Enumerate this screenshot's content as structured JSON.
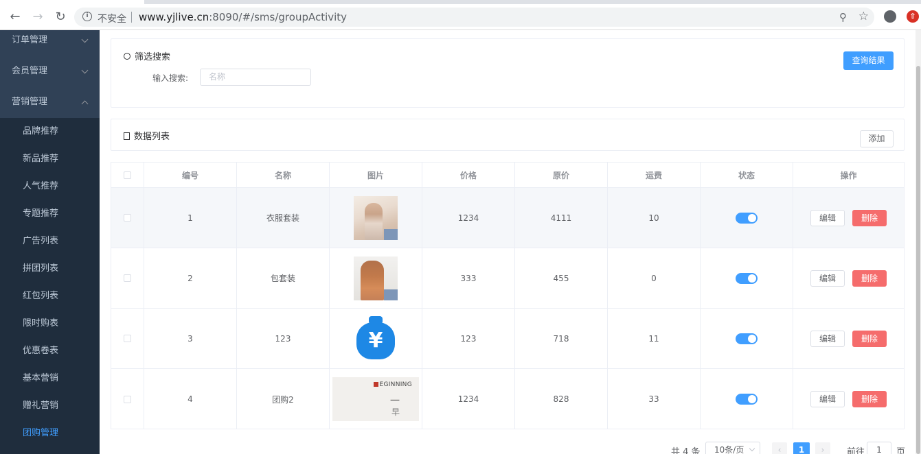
{
  "browser": {
    "security_label": "不安全",
    "url_host": "www.yjlive.cn",
    "url_rest": ":8090/#/sms/groupActivity"
  },
  "sidebar": {
    "groups": [
      {
        "label": "订单管理",
        "expanded": false
      },
      {
        "label": "会员管理",
        "expanded": false
      },
      {
        "label": "营销管理",
        "expanded": true
      }
    ],
    "items": [
      {
        "label": "品牌推荐"
      },
      {
        "label": "新品推荐"
      },
      {
        "label": "人气推荐"
      },
      {
        "label": "专题推荐"
      },
      {
        "label": "广告列表"
      },
      {
        "label": "拼团列表"
      },
      {
        "label": "红包列表"
      },
      {
        "label": "限时购表"
      },
      {
        "label": "优惠卷表"
      },
      {
        "label": "基本营销"
      },
      {
        "label": "赠礼营销"
      },
      {
        "label": "团购管理",
        "active": true
      }
    ]
  },
  "filter": {
    "title": "筛选搜索",
    "search_label": "输入搜索:",
    "search_placeholder": "名称",
    "query_button": "查询结果"
  },
  "list": {
    "title": "数据列表",
    "add_button": "添加"
  },
  "table": {
    "headers": [
      "编号",
      "名称",
      "图片",
      "价格",
      "原价",
      "运费",
      "状态",
      "操作"
    ],
    "rows": [
      {
        "id": "1",
        "name": "衣服套装",
        "image": "clothes-photo",
        "price": "1234",
        "original_price": "4111",
        "shipping": "10",
        "status_on": true
      },
      {
        "id": "2",
        "name": "包套装",
        "image": "bag-photo",
        "price": "333",
        "original_price": "455",
        "shipping": "0",
        "status_on": true
      },
      {
        "id": "3",
        "name": "123",
        "image": "money-bag-icon",
        "price": "123",
        "original_price": "718",
        "shipping": "11",
        "status_on": true
      },
      {
        "id": "4",
        "name": "团购2",
        "image": "group-photo",
        "price": "1234",
        "original_price": "828",
        "shipping": "33",
        "status_on": true
      }
    ],
    "edit_label": "编辑",
    "delete_label": "删除",
    "group_image": {
      "brand": "EGINNING",
      "line1": "一",
      "line2": "早"
    },
    "money_symbol": "¥"
  },
  "pagination": {
    "total_text": "共 4 条",
    "page_size": "10条/页",
    "current_page": "1",
    "goto_label": "前往",
    "goto_value": "1",
    "page_suffix": "页"
  },
  "colors": {
    "primary": "#409eff",
    "danger": "#f56c6c",
    "sidebar_bg": "#304156",
    "submenu_bg": "#1f2d3d"
  }
}
